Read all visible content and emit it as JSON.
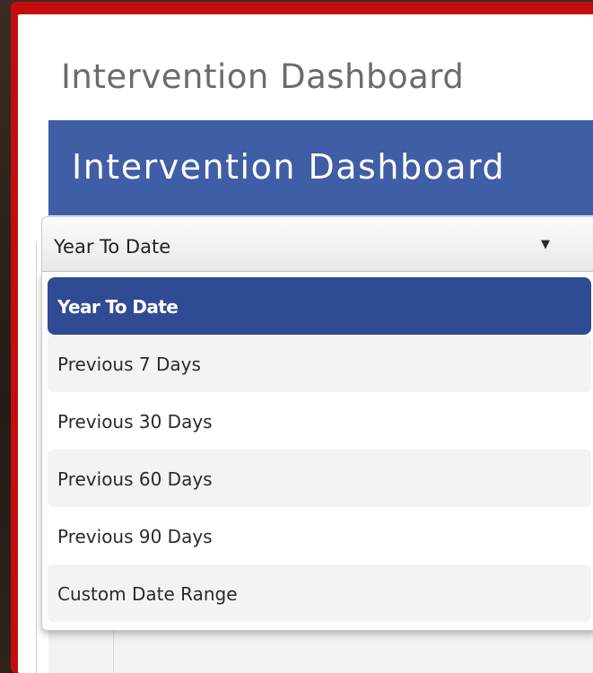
{
  "page": {
    "title": "Intervention Dashboard"
  },
  "header": {
    "title": "Intervention Dashboard"
  },
  "date_filter": {
    "selected_value": "Year To Date",
    "arrow_icon": "caret-down-icon",
    "options": [
      {
        "label": "Year To Date",
        "selected": true
      },
      {
        "label": "Previous 7 Days",
        "selected": false
      },
      {
        "label": "Previous 30 Days",
        "selected": false
      },
      {
        "label": "Previous 60 Days",
        "selected": false
      },
      {
        "label": "Previous 90 Days",
        "selected": false
      },
      {
        "label": "Custom Date Range",
        "selected": false
      }
    ]
  },
  "colors": {
    "modal_border": "#c40e0e",
    "header_band": "#3f5ea6",
    "selected_option": "#2f4b93"
  }
}
